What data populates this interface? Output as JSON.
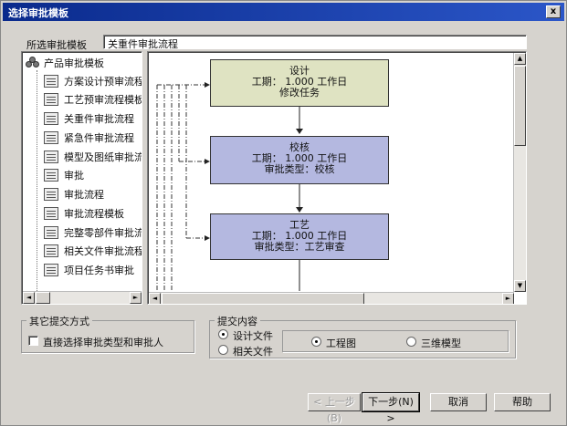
{
  "window": {
    "title": "选择审批模板",
    "close_glyph": "x"
  },
  "selected_template": {
    "label": "所选审批模板",
    "value": "关重件审批流程"
  },
  "tree": {
    "root_label": "产品审批模板",
    "items": [
      {
        "label": "方案设计预审流程"
      },
      {
        "label": "工艺预审流程模板"
      },
      {
        "label": "关重件审批流程"
      },
      {
        "label": "紧急件审批流程"
      },
      {
        "label": "模型及图纸审批流"
      },
      {
        "label": "审批"
      },
      {
        "label": "审批流程"
      },
      {
        "label": "审批流程模板"
      },
      {
        "label": "完整零部件审批流"
      },
      {
        "label": "相关文件审批流程"
      },
      {
        "label": "项目任务书审批"
      }
    ]
  },
  "flow": {
    "nodes": [
      {
        "title": "设计",
        "line1": "工期：    1.000 工作日",
        "line2": "修改任务",
        "color": "#dfe3c2"
      },
      {
        "title": "校核",
        "line1": "工期：    1.000 工作日",
        "line2": "审批类型：校核",
        "color": "#b4b8e0"
      },
      {
        "title": "工艺",
        "line1": "工期：    1.000 工作日",
        "line2": "审批类型：工艺审查",
        "color": "#b4b8e0"
      }
    ]
  },
  "other_submit": {
    "title": "其它提交方式",
    "checkbox_label": "直接选择审批类型和审批人",
    "checked": false
  },
  "submit_content": {
    "title": "提交内容",
    "options": [
      {
        "label": "设计文件",
        "selected": true
      },
      {
        "label": "相关文件",
        "selected": false
      }
    ],
    "sub_options": [
      {
        "label": "工程图",
        "selected": true
      },
      {
        "label": "三维模型",
        "selected": false
      }
    ]
  },
  "buttons": {
    "back": "< 上一步(B)",
    "next": "下一步(N) >",
    "cancel": "取消",
    "help": "帮助"
  },
  "scroll": {
    "left": "◄",
    "right": "►",
    "up": "▲",
    "down": "▼"
  }
}
